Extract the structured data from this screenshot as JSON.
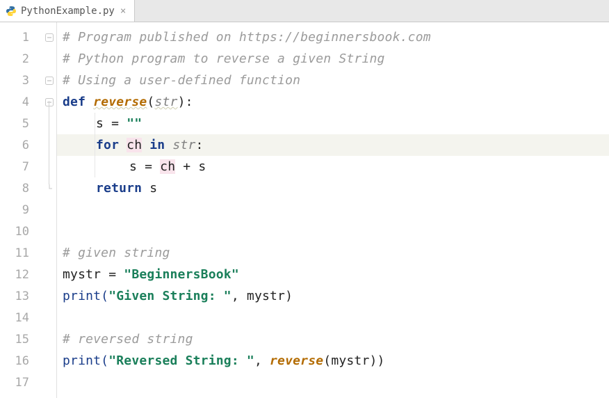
{
  "tab": {
    "filename": "PythonExample.py",
    "close_glyph": "×"
  },
  "editor": {
    "line_count": 17,
    "current_line": 6,
    "fold_markers": {
      "1": "start",
      "3": "start",
      "4": "start",
      "8": "end"
    },
    "code": {
      "l1": {
        "indent": 0,
        "tokens": [
          {
            "t": "# Program published on https://beginnersbook.com",
            "c": "c-comment"
          }
        ]
      },
      "l2": {
        "indent": 0,
        "tokens": [
          {
            "t": "# Python program to reverse a given String",
            "c": "c-comment"
          }
        ]
      },
      "l3": {
        "indent": 0,
        "tokens": [
          {
            "t": "# Using a user-defined function",
            "c": "c-comment"
          }
        ]
      },
      "l4": {
        "indent": 0,
        "tokens": [
          {
            "t": "def ",
            "c": "c-def"
          },
          {
            "t": "reverse",
            "c": "c-fname hl-wavy"
          },
          {
            "t": "(",
            "c": "c-plain"
          },
          {
            "t": "str",
            "c": "c-param hl-wavy"
          },
          {
            "t": "):",
            "c": "c-plain"
          }
        ]
      },
      "l5": {
        "indent": 1,
        "tokens": [
          {
            "t": "s = ",
            "c": "c-plain"
          },
          {
            "t": "\"\"",
            "c": "c-str"
          }
        ]
      },
      "l6": {
        "indent": 1,
        "tokens": [
          {
            "t": "for ",
            "c": "c-kw"
          },
          {
            "t": "ch",
            "c": "c-plain hl-pink"
          },
          {
            "t": " in ",
            "c": "c-kw"
          },
          {
            "t": "str",
            "c": "c-param"
          },
          {
            "t": ":",
            "c": "c-plain"
          }
        ]
      },
      "l7": {
        "indent": 2,
        "tokens": [
          {
            "t": "s = ",
            "c": "c-plain"
          },
          {
            "t": "ch",
            "c": "c-plain hl-pink"
          },
          {
            "t": " + s",
            "c": "c-plain"
          }
        ]
      },
      "l8": {
        "indent": 1,
        "tokens": [
          {
            "t": "return ",
            "c": "c-kw"
          },
          {
            "t": "s",
            "c": "c-plain"
          }
        ]
      },
      "l9": {
        "indent": 0,
        "tokens": []
      },
      "l10": {
        "indent": 0,
        "tokens": []
      },
      "l11": {
        "indent": 0,
        "tokens": [
          {
            "t": "# given string",
            "c": "c-comment"
          }
        ]
      },
      "l12": {
        "indent": 0,
        "tokens": [
          {
            "t": "mystr = ",
            "c": "c-plain"
          },
          {
            "t": "\"BeginnersBook\"",
            "c": "c-str"
          }
        ]
      },
      "l13": {
        "indent": 0,
        "tokens": [
          {
            "t": "print(",
            "c": "c-call"
          },
          {
            "t": "\"Given String: \"",
            "c": "c-str"
          },
          {
            "t": ", mystr)",
            "c": "c-plain"
          }
        ]
      },
      "l14": {
        "indent": 0,
        "tokens": []
      },
      "l15": {
        "indent": 0,
        "tokens": [
          {
            "t": "# reversed string",
            "c": "c-comment"
          }
        ]
      },
      "l16": {
        "indent": 0,
        "tokens": [
          {
            "t": "print(",
            "c": "c-call"
          },
          {
            "t": "\"Reversed String: \"",
            "c": "c-str"
          },
          {
            "t": ", ",
            "c": "c-plain"
          },
          {
            "t": "reverse",
            "c": "c-fname"
          },
          {
            "t": "(mystr))",
            "c": "c-plain"
          }
        ]
      },
      "l17": {
        "indent": 0,
        "tokens": []
      }
    }
  }
}
